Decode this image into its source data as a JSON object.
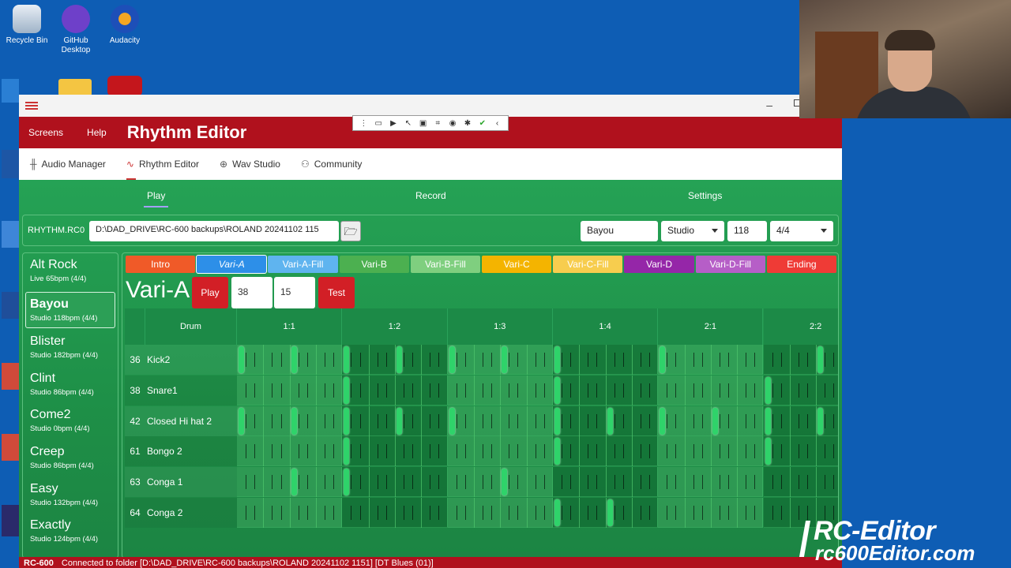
{
  "desktop": {
    "icons": [
      {
        "label": "Recycle Bin"
      },
      {
        "label": "GitHub Desktop"
      },
      {
        "label": "Audacity"
      }
    ]
  },
  "window": {
    "menu": [
      "Screens",
      "Help"
    ],
    "title": "Rhythm Editor"
  },
  "nav": [
    {
      "label": "Audio Manager",
      "icon": "waveform-icon"
    },
    {
      "label": "Rhythm Editor",
      "icon": "pulse-icon"
    },
    {
      "label": "Wav Studio",
      "icon": "play-circle-icon"
    },
    {
      "label": "Community",
      "icon": "people-icon"
    }
  ],
  "subtabs": [
    "Play",
    "Record",
    "Settings"
  ],
  "pathbar": {
    "label": "RHYTHM.RC0",
    "path": "D:\\DAD_DRIVE\\RC-600 backups\\ROLAND 20241102 115",
    "name": "Bayou",
    "kit": "Studio",
    "tempo": "118",
    "time_sig": "4/4"
  },
  "rhythms": [
    {
      "name": "Alt Rock",
      "sub": "Live 65bpm (4/4)"
    },
    {
      "name": "Bayou",
      "sub": "Studio 118bpm (4/4)",
      "selected": true
    },
    {
      "name": "Blister",
      "sub": "Studio 182bpm (4/4)"
    },
    {
      "name": "Clint",
      "sub": "Studio 86bpm (4/4)"
    },
    {
      "name": "Come2",
      "sub": "Studio 0bpm (4/4)"
    },
    {
      "name": "Creep",
      "sub": "Studio 86bpm (4/4)"
    },
    {
      "name": "Easy",
      "sub": "Studio 132bpm (4/4)"
    },
    {
      "name": "Exactly",
      "sub": "Studio 124bpm (4/4)"
    }
  ],
  "parts": [
    {
      "label": "Intro",
      "color": "#f05a28"
    },
    {
      "label": "Vari-A",
      "color": "#2d8fe8",
      "active": true
    },
    {
      "label": "Vari-A-Fill",
      "color": "#5fb4ef"
    },
    {
      "label": "Vari-B",
      "color": "#4cb050"
    },
    {
      "label": "Vari-B-Fill",
      "color": "#7fcf7f"
    },
    {
      "label": "Vari-C",
      "color": "#f4b400"
    },
    {
      "label": "Vari-C-Fill",
      "color": "#f7cd4e"
    },
    {
      "label": "Vari-D",
      "color": "#9526a8"
    },
    {
      "label": "Vari-D-Fill",
      "color": "#b65ec7"
    },
    {
      "label": "Ending",
      "color": "#ef3b36"
    }
  ],
  "section": {
    "name": "Vari-A",
    "play_label": "Play",
    "value1": "38",
    "value2": "15",
    "test_label": "Test"
  },
  "grid": {
    "drum_header": "Drum",
    "beats": [
      "1:1",
      "1:2",
      "1:3",
      "1:4",
      "2:1",
      "2:2"
    ],
    "rows": [
      {
        "num": "36",
        "name": "Kick2",
        "notes": [
          0,
          0.5,
          1,
          1.5,
          2,
          2.5,
          3,
          4,
          5.5
        ]
      },
      {
        "num": "38",
        "name": "Snare1",
        "notes": [
          1,
          3,
          5
        ]
      },
      {
        "num": "42",
        "name": "Closed Hi hat 2",
        "notes": [
          0,
          0.5,
          1,
          1.5,
          2,
          3,
          3.5,
          4,
          4.5,
          5,
          5.5
        ]
      },
      {
        "num": "61",
        "name": "Bongo 2",
        "notes": [
          1,
          3,
          5
        ]
      },
      {
        "num": "63",
        "name": "Conga 1",
        "notes": [
          0.5,
          1,
          2.5
        ]
      },
      {
        "num": "64",
        "name": "Conga 2",
        "notes": [
          3,
          3.5
        ]
      }
    ]
  },
  "status": {
    "device": "RC-600",
    "text": "Connected to folder [D:\\DAD_DRIVE\\RC-600 backups\\ROLAND 20241102 1151] [DT Blues (01)]"
  },
  "watermark": {
    "line1": "RC-Editor",
    "line2": "rc600Editor.com"
  }
}
